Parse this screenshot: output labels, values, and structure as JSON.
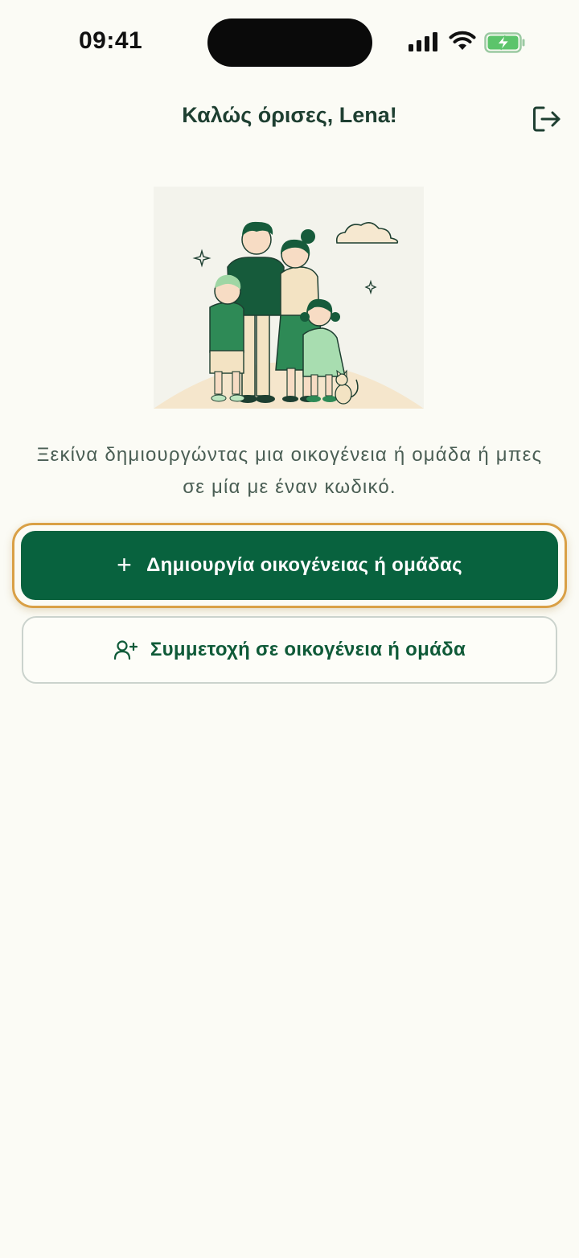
{
  "status_bar": {
    "time": "09:41",
    "icons": [
      "signal-icon",
      "wifi-icon",
      "battery-charging-icon"
    ]
  },
  "header": {
    "title": "Καλώς όρισες, Lena!",
    "logout_icon": "logout-icon"
  },
  "illustration": {
    "icon": "family-illustration"
  },
  "intro": {
    "text": "Ξεκίνα δημιουργώντας μια οικογένεια ή ομάδα ή μπες σε μία με έναν κωδικό."
  },
  "actions": {
    "create_label": "Δημιουργία οικογένειας ή ομάδας",
    "create_icon": "plus-icon",
    "join_label": "Συμμετοχή σε οικογένεια ή ομάδα",
    "join_icon": "user-plus-icon"
  },
  "colors": {
    "background": "#FBFBF5",
    "primary_green": "#08623E",
    "focus_ring": "#D9A046",
    "text_dark": "#1E3F31",
    "battery_green": "#5CC46B"
  }
}
